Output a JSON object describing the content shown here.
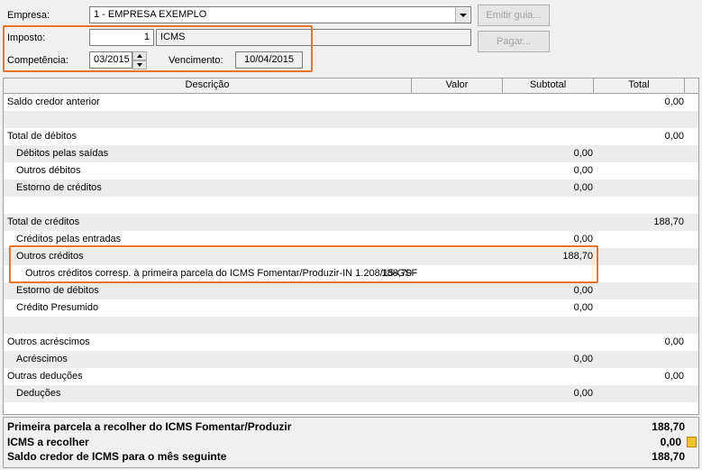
{
  "header": {
    "empresa_label": "Empresa:",
    "empresa_value": "1 - EMPRESA EXEMPLO",
    "imposto_label": "Imposto:",
    "imposto_code": "1",
    "imposto_name": "ICMS",
    "competencia_label": "Competência:",
    "competencia_value": "03/2015",
    "vencimento_label": "Vencimento:",
    "vencimento_value": "10/04/2015",
    "emitir_guia_label": "Emitir guia...",
    "pagar_label": "Pagar..."
  },
  "grid": {
    "columns": [
      "Descrição",
      "Valor",
      "Subtotal",
      "Total"
    ],
    "rows": [
      {
        "desc": "Saldo credor anterior",
        "indent": 0,
        "valor": "",
        "subtotal": "",
        "total": "0,00"
      },
      {
        "desc": "",
        "indent": 0,
        "valor": "",
        "subtotal": "",
        "total": ""
      },
      {
        "desc": "Total de débitos",
        "indent": 0,
        "valor": "",
        "subtotal": "",
        "total": "0,00"
      },
      {
        "desc": "Débitos pelas saídas",
        "indent": 1,
        "valor": "",
        "subtotal": "0,00",
        "total": ""
      },
      {
        "desc": "Outros débitos",
        "indent": 1,
        "valor": "",
        "subtotal": "0,00",
        "total": ""
      },
      {
        "desc": "Estorno de créditos",
        "indent": 1,
        "valor": "",
        "subtotal": "0,00",
        "total": ""
      },
      {
        "desc": "",
        "indent": 0,
        "valor": "",
        "subtotal": "",
        "total": ""
      },
      {
        "desc": "Total de créditos",
        "indent": 0,
        "valor": "",
        "subtotal": "",
        "total": "188,70"
      },
      {
        "desc": "Créditos pelas entradas",
        "indent": 1,
        "valor": "",
        "subtotal": "0,00",
        "total": ""
      },
      {
        "desc": "Outros créditos",
        "indent": 1,
        "valor": "",
        "subtotal": "188,70",
        "total": ""
      },
      {
        "desc": "Outros créditos corresp. à primeira parcela do ICMS Fomentar/Produzir-IN 1.208/15-GSF",
        "indent": 2,
        "valor": "188,70",
        "subtotal": "",
        "total": ""
      },
      {
        "desc": "Estorno de débitos",
        "indent": 1,
        "valor": "",
        "subtotal": "0,00",
        "total": ""
      },
      {
        "desc": "Crédito Presumido",
        "indent": 1,
        "valor": "",
        "subtotal": "0,00",
        "total": ""
      },
      {
        "desc": "",
        "indent": 0,
        "valor": "",
        "subtotal": "",
        "total": ""
      },
      {
        "desc": "Outros acréscimos",
        "indent": 0,
        "valor": "",
        "subtotal": "",
        "total": "0,00"
      },
      {
        "desc": "Acréscimos",
        "indent": 1,
        "valor": "",
        "subtotal": "0,00",
        "total": ""
      },
      {
        "desc": "Outras deduções",
        "indent": 0,
        "valor": "",
        "subtotal": "",
        "total": "0,00"
      },
      {
        "desc": "Deduções",
        "indent": 1,
        "valor": "",
        "subtotal": "0,00",
        "total": ""
      },
      {
        "desc": "",
        "indent": 0,
        "valor": "",
        "subtotal": "",
        "total": ""
      }
    ]
  },
  "summary": {
    "primeira_parcela_label": "Primeira parcela a recolher do ICMS Fomentar/Produzir",
    "primeira_parcela_value": "188,70",
    "icms_recolher_label": "ICMS a recolher",
    "icms_recolher_value": "0,00",
    "saldo_credor_label": "Saldo credor de ICMS para o mês seguinte",
    "saldo_credor_value": "188,70"
  },
  "colors": {
    "highlight": "#e8742a",
    "row_alt": "#ececec"
  }
}
